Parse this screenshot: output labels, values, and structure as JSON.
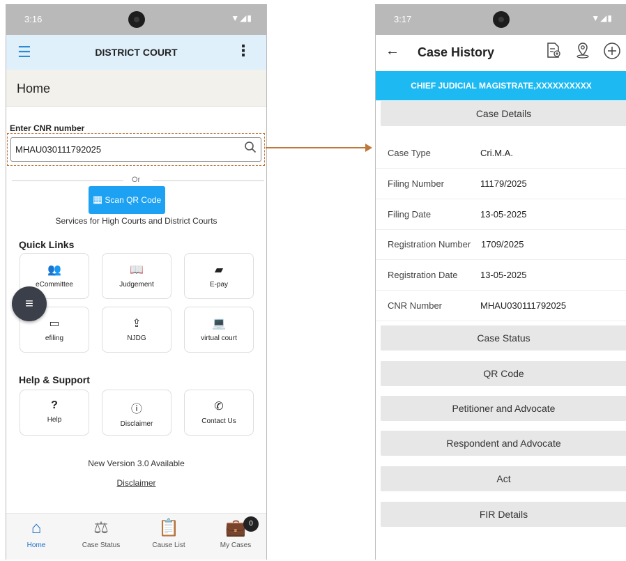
{
  "left_screen": {
    "status_time": "3:16",
    "status_icons": "▼◢▮",
    "app_title": "DISTRICT COURT",
    "page_title": "Home",
    "cnr_label": "Enter CNR number",
    "cnr_value": "MHAU030111792025",
    "or_text": "Or",
    "scan_button": "Scan QR Code",
    "services_text": "Services for High Courts and District Courts",
    "quick_links_title": "Quick Links",
    "quick_links": [
      {
        "label": "eCommittee",
        "icon": "users-icon"
      },
      {
        "label": "Judgement",
        "icon": "book-icon"
      },
      {
        "label": "E-pay",
        "icon": "wallet-icon"
      },
      {
        "label": "efiling",
        "icon": "window-icon"
      },
      {
        "label": "NJDG",
        "icon": "upload-screen-icon"
      },
      {
        "label": "virtual court",
        "icon": "laptop-icon"
      }
    ],
    "help_title": "Help & Support",
    "help_links": [
      {
        "label": "Help",
        "icon": "question-icon"
      },
      {
        "label": "Disclaimer",
        "icon": "info-icon"
      },
      {
        "label": "Contact Us",
        "icon": "phone-icon"
      }
    ],
    "new_version": "New Version 3.0 Available",
    "disclaimer_link": "Disclaimer",
    "bottom_nav": [
      {
        "label": "Home",
        "icon": "home-icon"
      },
      {
        "label": "Case Status",
        "icon": "scales-icon"
      },
      {
        "label": "Cause List",
        "icon": "clipboard-icon"
      },
      {
        "label": "My Cases",
        "icon": "briefcase-icon"
      }
    ],
    "my_cases_badge": "0"
  },
  "right_screen": {
    "status_time": "3:17",
    "status_icons": "▼◢▮",
    "title": "Case History",
    "court_banner": "CHIEF JUDICIAL MAGISTRATE,XXXXXXXXXX",
    "case_details_header": "Case Details",
    "details": [
      {
        "key": "Case Type",
        "value": "Cri.M.A."
      },
      {
        "key": "Filing Number",
        "value": "11179/2025"
      },
      {
        "key": "Filing Date",
        "value": "13-05-2025"
      },
      {
        "key": "Registration Number",
        "value": "1709/2025"
      },
      {
        "key": "Registration Date",
        "value": "13-05-2025"
      },
      {
        "key": "CNR Number",
        "value": "MHAU030111792025"
      }
    ],
    "sections": [
      "Case Status",
      "QR Code",
      "Petitioner and Advocate",
      "Respondent and Advocate",
      "Act",
      "FIR Details"
    ]
  },
  "colors": {
    "appbar_bg": "#dff0fb",
    "banner_bg": "#1cb9f2",
    "scan_button_bg": "#1da1f2",
    "annotation": "#c0773a",
    "nav_active": "#1d6ec5"
  }
}
